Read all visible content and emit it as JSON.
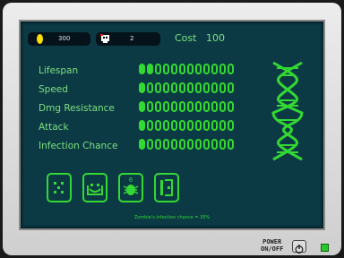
{
  "hud": {
    "coins": "300",
    "zombies": "2",
    "cost_label": "Cost",
    "cost_value": "100"
  },
  "stats": [
    {
      "label": "Lifespan",
      "level": 2,
      "max": 12
    },
    {
      "label": "Speed",
      "level": 1,
      "max": 12
    },
    {
      "label": "Dmg Resistance",
      "level": 1,
      "max": 12
    },
    {
      "label": "Attack",
      "level": 1,
      "max": 12
    },
    {
      "label": "Infection Chance",
      "level": 1,
      "max": 12
    }
  ],
  "abilities": [
    {
      "icon": "dice-icon"
    },
    {
      "icon": "zombie-face-icon"
    },
    {
      "icon": "bug-icon",
      "badge": "0"
    },
    {
      "icon": "wall-icon"
    }
  ],
  "info_text": "Zombie's infection chance = 35%",
  "power": {
    "label_line1": "POWER",
    "label_line2": "ON/OFF"
  },
  "colors": {
    "screen": "#0b3a45",
    "accent": "#33d833",
    "text": "#7ee07e",
    "coin": "#ffe000"
  }
}
